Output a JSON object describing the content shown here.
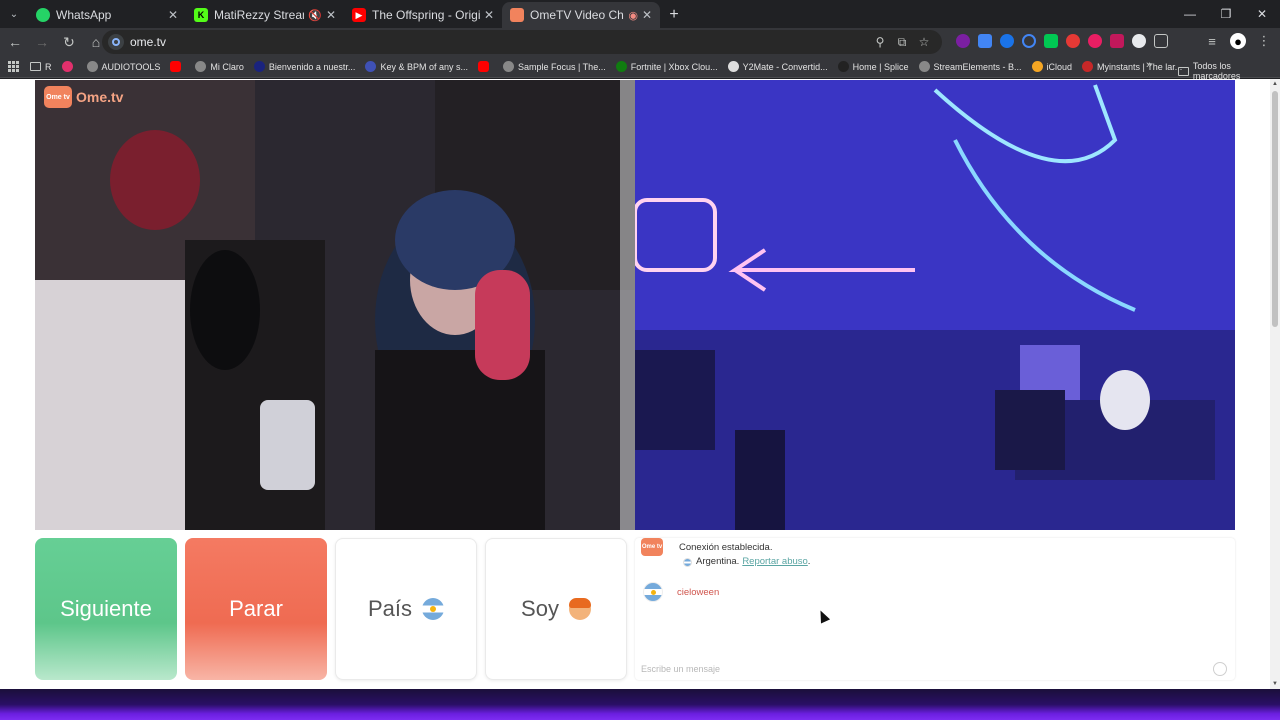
{
  "browser": {
    "tabs": [
      {
        "title": "WhatsApp",
        "favicon_color": "#25D366",
        "favicon_icon": "whatsapp-icon"
      },
      {
        "title": "MatiRezzy Stream - Watch L",
        "favicon_color": "#53FC18",
        "favicon_icon": "kick-icon",
        "extra": "muted-icon"
      },
      {
        "title": "The Offspring - Original Pranks",
        "favicon_color": "#FF0000",
        "favicon_icon": "youtube-icon"
      },
      {
        "title": "OmeTV Video Chat — Onv",
        "favicon_color": "#F1835D",
        "favicon_icon": "ometv-icon",
        "extra": "recording-icon",
        "active": true
      }
    ],
    "url": "ome.tv",
    "bookmarks": [
      {
        "label": "R",
        "color": "#5f6368"
      },
      {
        "label": "",
        "color": "#E1306C"
      },
      {
        "label": "AUDIOTOOLS",
        "color": "#888888"
      },
      {
        "label": "",
        "color": "#FF0000"
      },
      {
        "label": "Mi Claro",
        "color": "#888888"
      },
      {
        "label": "Bienvenido a nuestr...",
        "color": "#1a237e"
      },
      {
        "label": "Key & BPM of any s...",
        "color": "#3f51b5"
      },
      {
        "label": "",
        "color": "#FF0000"
      },
      {
        "label": "Sample Focus | The...",
        "color": "#888888"
      },
      {
        "label": "Fortnite | Xbox Clou...",
        "color": "#107C10"
      },
      {
        "label": "Y2Mate - Convertid...",
        "color": "#dddddd"
      },
      {
        "label": "Home | Splice",
        "color": "#222222"
      },
      {
        "label": "StreamElements - B...",
        "color": "#888888"
      },
      {
        "label": "iCloud",
        "color": "#f5a623"
      },
      {
        "label": "Myinstants | The lar...",
        "color": "#c62828"
      }
    ],
    "all_bookmarks": "Todos los marcadores"
  },
  "page": {
    "logo": "Ome.tv",
    "logo_badge": "Ome tv",
    "buttons": {
      "next": "Siguiente",
      "stop": "Parar",
      "country": "País",
      "gender": "Soy"
    },
    "chat": {
      "system_message": "Conexión establecida.",
      "country": "Argentina.",
      "report": "Reportar abuso",
      "report_suffix": ".",
      "user_message": "cieloween",
      "input_placeholder": "Escribe un mensaje"
    }
  },
  "colors": {
    "next_button": "#5DC68A",
    "stop_button": "#EF6B52",
    "brand": "#F1835D",
    "link": "#5AA5A3",
    "user_message": "#D0554D"
  }
}
